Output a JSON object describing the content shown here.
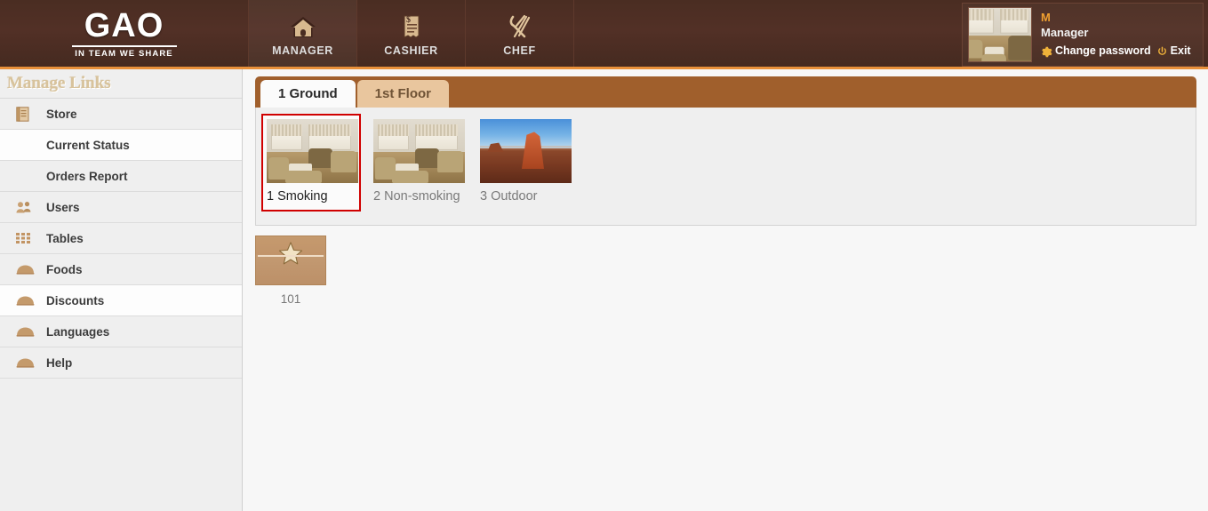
{
  "header": {
    "logo": {
      "text": "GAO",
      "tagline": "IN TEAM WE SHARE"
    },
    "nav": [
      {
        "label": "MANAGER",
        "icon": "home-icon",
        "active": true
      },
      {
        "label": "CASHIER",
        "icon": "receipt-icon",
        "active": false
      },
      {
        "label": "CHEF",
        "icon": "fork-knife-icon",
        "active": false
      }
    ],
    "user": {
      "initial": "M",
      "role": "Manager",
      "change_password_label": "Change password",
      "exit_label": "Exit",
      "avatar_alt": "restaurant-interior"
    }
  },
  "sidebar": {
    "title": "Manage Links",
    "items": [
      {
        "label": "Store",
        "icon": "book-icon",
        "sub": false,
        "highlight": false
      },
      {
        "label": "Current Status",
        "icon": "",
        "sub": true,
        "highlight": true
      },
      {
        "label": "Orders Report",
        "icon": "",
        "sub": true,
        "highlight": false
      },
      {
        "label": "Users",
        "icon": "users-icon",
        "sub": false,
        "highlight": false
      },
      {
        "label": "Tables",
        "icon": "grid-icon",
        "sub": false,
        "highlight": false
      },
      {
        "label": "Foods",
        "icon": "dome-icon",
        "sub": false,
        "highlight": false
      },
      {
        "label": "Discounts",
        "icon": "dome-icon",
        "sub": false,
        "highlight": true
      },
      {
        "label": "Languages",
        "icon": "dome-icon",
        "sub": false,
        "highlight": false
      },
      {
        "label": "Help",
        "icon": "dome-icon",
        "sub": false,
        "highlight": false
      }
    ]
  },
  "main": {
    "tabs": [
      {
        "label": "1 Ground",
        "active": true
      },
      {
        "label": "1st Floor",
        "active": false
      }
    ],
    "areas": [
      {
        "label": "1 Smoking",
        "thumb": "interior",
        "selected": true
      },
      {
        "label": "2 Non-smoking",
        "thumb": "interior",
        "selected": false
      },
      {
        "label": "3 Outdoor",
        "thumb": "desert",
        "selected": false
      }
    ],
    "tables": [
      {
        "label": "101",
        "icon": "star-icon"
      }
    ]
  },
  "colors": {
    "header_brown": "#4a2d22",
    "accent_orange": "#e8903a",
    "tabstrip_brown": "#a05f2c",
    "tab_inactive": "#e9c69e",
    "selected_border": "#d00000",
    "table_tan": "#c59a6e",
    "panel_gray": "#efefef"
  }
}
